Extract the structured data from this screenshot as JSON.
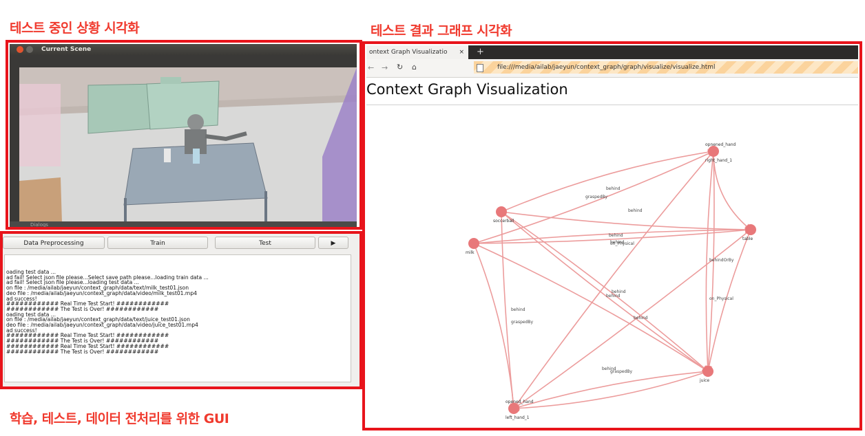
{
  "captions": {
    "scene": "테스트 중인 상황 시각화",
    "graph": "테스트 결과 그래프 시각화",
    "gui": "학습, 테스트, 데이터 전처리를 위한 GUI"
  },
  "scene_window": {
    "title": "Current Scene",
    "dialog_label": "Dialogs"
  },
  "gui": {
    "buttons": {
      "preprocess": "Data Preprocessing",
      "train": "Train",
      "test": "Test",
      "play": "▶"
    },
    "log_lines": [
      "oading test data ...",
      "ad fail! Select json file please...Select save path please...loading train data ...",
      "ad fail! Select json file please...loading test data ...",
      "on file : /media/ailab/jaeyun/context_graph/data/text/milk_test01.json",
      "deo file : /media/ailab/jaeyun/context_graph/data/video/milk_test01.mp4",
      "ad success!",
      "############ Real Time Test Start! ############",
      "############ The Test is Over! ############",
      "oading test data ...",
      "on file : /media/ailab/jaeyun/context_graph/data/text/juice_test01.json",
      "deo file : /media/ailab/jaeyun/context_graph/data/video/juice_test01.mp4",
      "ad success!",
      "############ Real Time Test Start! ############",
      "############ The Test is Over! ############",
      "############ Real Time Test Start! ############",
      "############ The Test is Over! ############"
    ]
  },
  "browser": {
    "tab_title": "ontext Graph Visualizatio",
    "tab_close": "×",
    "new_tab": "+",
    "url": "file:///media/ailab/jaeyun/context_graph/graph/visualize/visualize.html",
    "page_title": "Context Graph Visualization",
    "node_color": "#e8787a",
    "edge_color": "#ec9c9c",
    "graph": {
      "nodes": [
        {
          "id": "right_hand_1",
          "top": "opnened_hand",
          "bottom": "right_hand_1"
        },
        {
          "id": "soccerball",
          "top": "",
          "bottom": "soccerball"
        },
        {
          "id": "table",
          "top": "",
          "bottom": "table"
        },
        {
          "id": "milk",
          "top": "",
          "bottom": "milk"
        },
        {
          "id": "juice",
          "top": "",
          "bottom": "juice"
        },
        {
          "id": "left_hand_1",
          "top": "opened_hand",
          "bottom": "left_hand_1"
        }
      ],
      "edge_labels": [
        "behind",
        "graspedBy",
        "behind",
        "behind",
        "behind",
        "on_Physical",
        "behindOrBy",
        "on_Physical",
        "behind",
        "behind",
        "behind",
        "behind",
        "graspedBy",
        "behind",
        "graspedBy"
      ]
    }
  }
}
